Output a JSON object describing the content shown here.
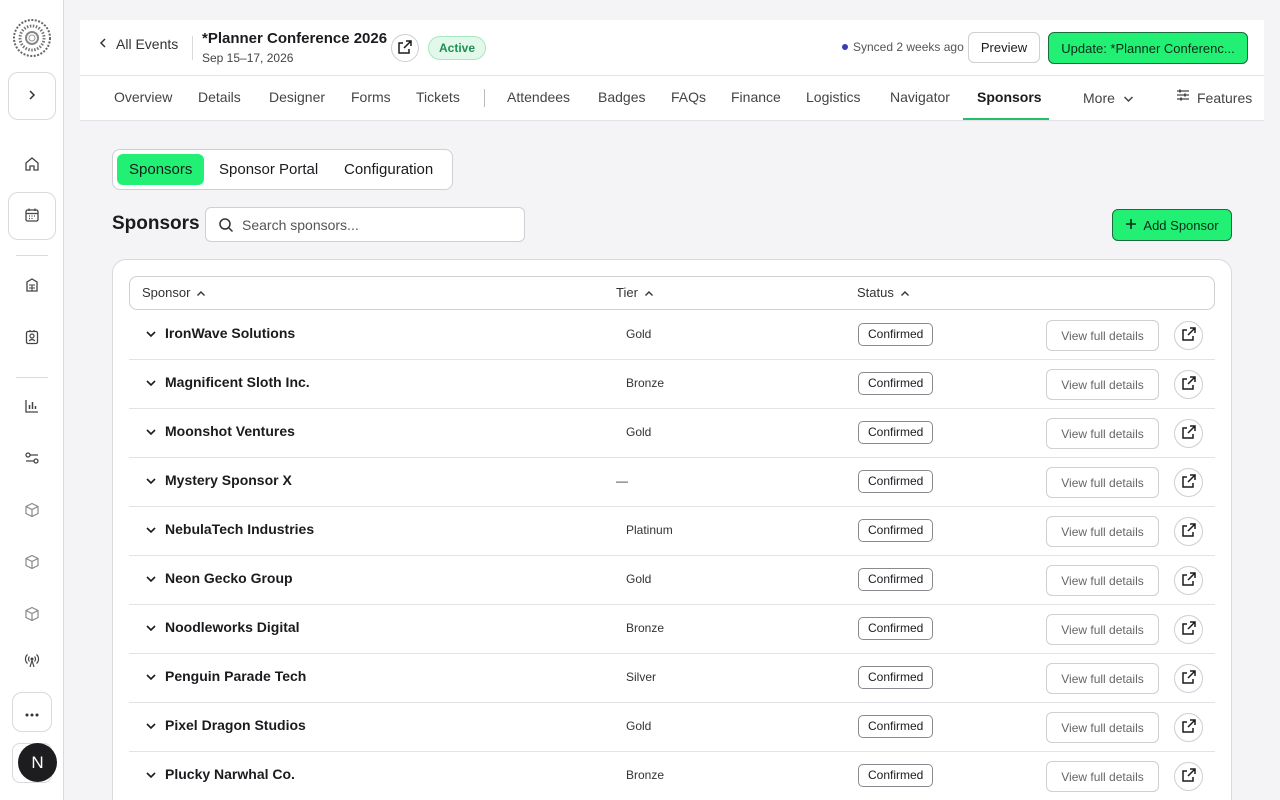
{
  "sidebar": {
    "logo_icon": "sunburst-logo-icon",
    "expand_icon": "chevron-right-icon",
    "icons": [
      "home-icon",
      "calendar-icon",
      "building-icon",
      "badge-icon",
      "bar-chart-icon",
      "sliders-icon",
      "cube-icon",
      "cube-icon",
      "cube-icon",
      "broadcast-icon",
      "more-dots-icon"
    ],
    "avatar_letter": "N"
  },
  "header": {
    "back_label": "All Events",
    "event_title": "*Planner Conference 2026",
    "event_date": "Sep 15–17, 2026",
    "status_badge": "Active",
    "sync_text": "Synced 2 weeks ago",
    "preview_label": "Preview",
    "update_label": "Update: *Planner Conferenc..."
  },
  "nav": {
    "tabs": [
      "Overview",
      "Details",
      "Designer",
      "Forms",
      "Tickets",
      "Attendees",
      "Badges",
      "FAQs",
      "Finance",
      "Logistics",
      "Navigator",
      "Sponsors"
    ],
    "active_tab": "Sponsors",
    "more_label": "More",
    "features_label": "Features"
  },
  "subtabs": {
    "items": [
      "Sponsors",
      "Sponsor Portal",
      "Configuration"
    ],
    "active": "Sponsors"
  },
  "section": {
    "title": "Sponsors",
    "search_placeholder": "Search sponsors...",
    "add_label": "Add Sponsor"
  },
  "table": {
    "columns": [
      "Sponsor",
      "Tier",
      "Status"
    ],
    "view_label": "View full details",
    "rows": [
      {
        "name": "IronWave Solutions",
        "tier": "Gold",
        "status": "Confirmed"
      },
      {
        "name": "Magnificent Sloth Inc.",
        "tier": "Bronze",
        "status": "Confirmed"
      },
      {
        "name": "Moonshot Ventures",
        "tier": "Gold",
        "status": "Confirmed"
      },
      {
        "name": "Mystery Sponsor X",
        "tier": "—",
        "status": "Confirmed"
      },
      {
        "name": "NebulaTech Industries",
        "tier": "Platinum",
        "status": "Confirmed"
      },
      {
        "name": "Neon Gecko Group",
        "tier": "Gold",
        "status": "Confirmed"
      },
      {
        "name": "Noodleworks Digital",
        "tier": "Bronze",
        "status": "Confirmed"
      },
      {
        "name": "Penguin Parade Tech",
        "tier": "Silver",
        "status": "Confirmed"
      },
      {
        "name": "Pixel Dragon Studios",
        "tier": "Gold",
        "status": "Confirmed"
      },
      {
        "name": "Plucky Narwhal Co.",
        "tier": "Bronze",
        "status": "Confirmed"
      }
    ]
  },
  "colors": {
    "accent": "#22f075",
    "accent_border": "#1a6c3c",
    "active_badge_bg": "#e2f8ea",
    "active_badge_text": "#1f8f52"
  }
}
